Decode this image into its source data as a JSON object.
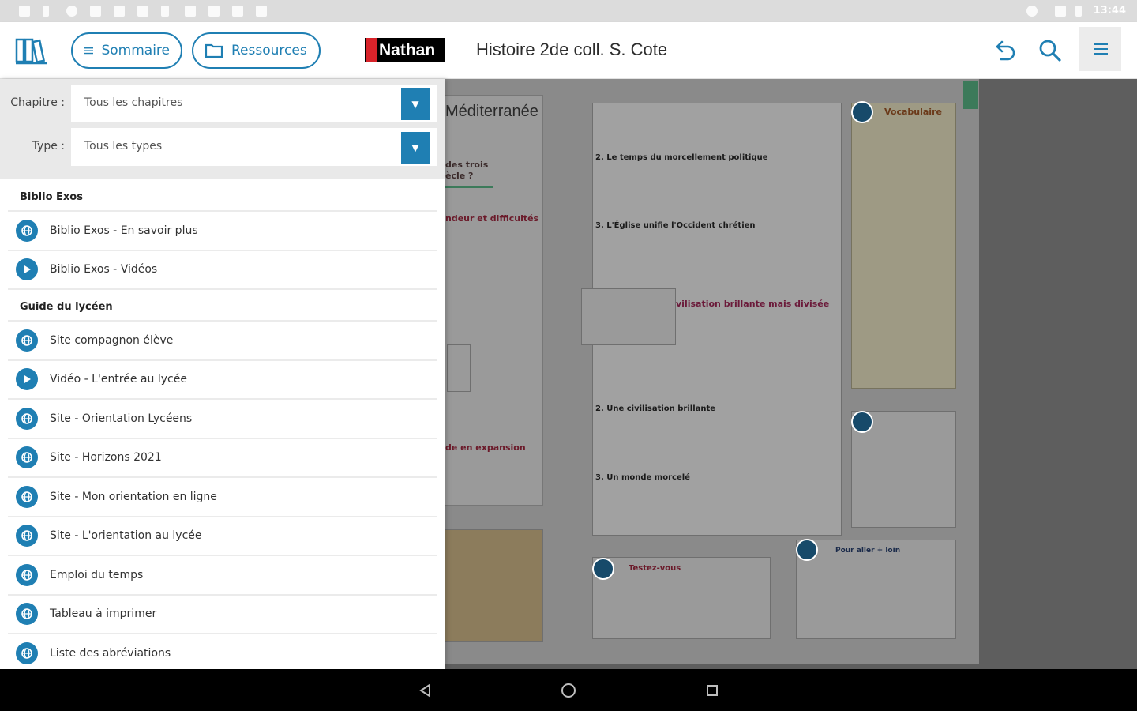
{
  "status_bar": {
    "time": "13:44"
  },
  "header": {
    "sommaire_label": "Sommaire",
    "ressources_label": "Ressources",
    "logo_text": "Nathan",
    "book_title": "Histoire 2de coll. S. Cote"
  },
  "filters": {
    "chapitre_label": "Chapitre :",
    "chapitre_value": "Tous les chapitres",
    "type_label": "Type :",
    "type_value": "Tous les types"
  },
  "sections": [
    {
      "title": "Biblio Exos",
      "items": [
        {
          "label": "Biblio Exos - En savoir plus",
          "icon": "link-icon"
        },
        {
          "label": "Biblio Exos - Vidéos",
          "icon": "play-icon"
        }
      ]
    },
    {
      "title": "Guide du lycéen",
      "items": [
        {
          "label": "Site compagnon élève",
          "icon": "link-icon"
        },
        {
          "label": "Vidéo - L'entrée au lycée",
          "icon": "play-icon"
        },
        {
          "label": "Site - Orientation Lycéens",
          "icon": "link-icon"
        },
        {
          "label": "Site - Horizons 2021",
          "icon": "link-icon"
        },
        {
          "label": "Site - Mon orientation en ligne",
          "icon": "link-icon"
        },
        {
          "label": "Site - L'orientation au lycée",
          "icon": "link-icon"
        },
        {
          "label": "Emploi du temps",
          "icon": "link-icon"
        },
        {
          "label": "Tableau à imprimer",
          "icon": "link-icon"
        },
        {
          "label": "Liste des abréviations",
          "icon": "link-icon"
        }
      ]
    }
  ],
  "page_preview": {
    "title": "Méditerranée",
    "subtitle_1": "des trois",
    "subtitle_2": "ècle ?",
    "red_1": "ndeur et difficultés",
    "red_2": "de en expansion",
    "heading_1": "2. Le temps du morcellement politique",
    "heading_2": "3. L'Église unifie l'Occident chrétien",
    "red_heading": "vilisation brillante mais divisée",
    "heading_3": "2. Une civilisation brillante",
    "heading_4": "3. Un monde morcelé",
    "side_title": "Vocabulaire",
    "side_box_title": "Testez-vous",
    "aller_plus_loin": "Pour aller + loin"
  },
  "colors": {
    "accent": "#1f7fb3",
    "brand_red": "#d8232a"
  }
}
